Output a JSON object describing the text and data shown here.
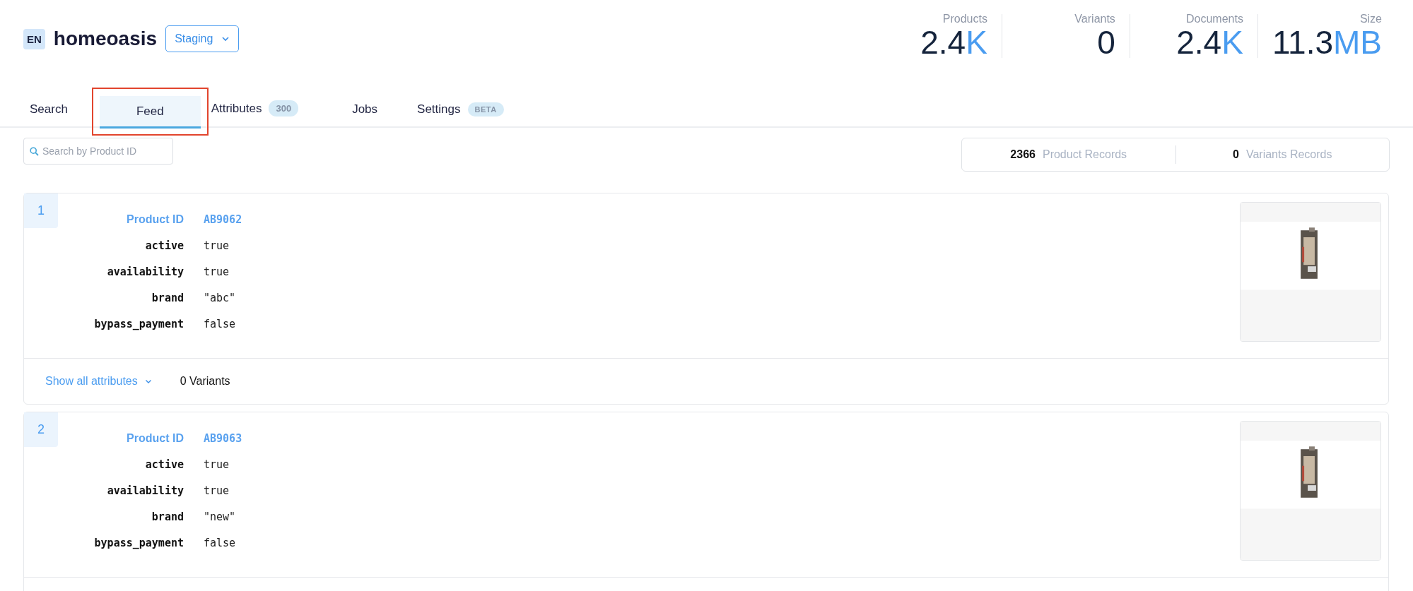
{
  "header": {
    "language": "EN",
    "title": "homeoasis",
    "environment": "Staging"
  },
  "stats": [
    {
      "label": "Products",
      "value": "2.4",
      "unit": "K"
    },
    {
      "label": "Variants",
      "value": "0"
    },
    {
      "label": "Documents",
      "value": "2.4",
      "unit": "K"
    },
    {
      "label": "Size",
      "value": "11.3",
      "unit": "MB"
    }
  ],
  "tabs": [
    {
      "label": "Search",
      "selected": false,
      "annotated": false
    },
    {
      "label": "Feed",
      "selected": true,
      "annotated": true
    },
    {
      "label": "Attributes",
      "kind": "count",
      "badge": "300",
      "selected": false,
      "annotated": false
    },
    {
      "label": "Jobs",
      "selected": false,
      "annotated": false
    },
    {
      "label": "Settings",
      "kind": "tag",
      "badge": "BETA",
      "selected": false,
      "annotated": false
    }
  ],
  "search": {
    "placeholder": "Search by Product ID"
  },
  "records": [
    {
      "count": "2366",
      "label": "Product Records"
    },
    {
      "count": "0",
      "label": "Variants Records"
    }
  ],
  "products": [
    {
      "index": "1",
      "id_label": "Product ID",
      "id": "AB9062",
      "attributes": [
        {
          "key": "active",
          "value": "true"
        },
        {
          "key": "availability",
          "value": "true"
        },
        {
          "key": "brand",
          "value": "\"abc\""
        },
        {
          "key": "bypass_payment",
          "value": "false"
        }
      ],
      "show_all": "Show all attributes",
      "variants": "0 Variants"
    },
    {
      "index": "2",
      "id_label": "Product ID",
      "id": "AB9063",
      "attributes": [
        {
          "key": "active",
          "value": "true"
        },
        {
          "key": "availability",
          "value": "true"
        },
        {
          "key": "brand",
          "value": "\"new\""
        },
        {
          "key": "bypass_payment",
          "value": "false"
        }
      ]
    }
  ]
}
